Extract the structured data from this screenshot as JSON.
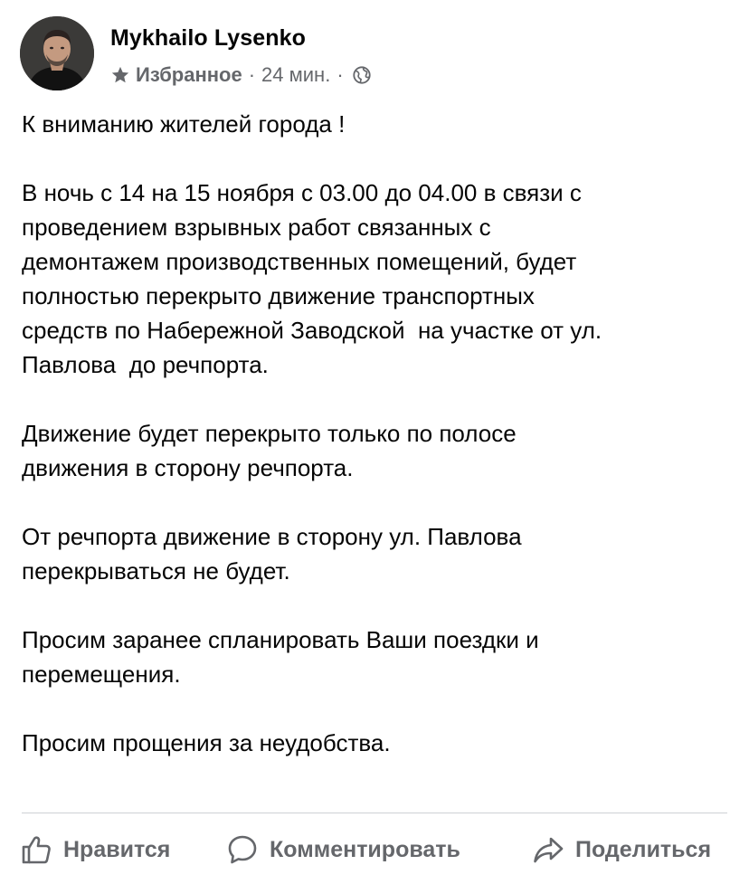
{
  "post": {
    "author": "Mykhailo Lysenko",
    "meta": {
      "favorite_label": "Избранное",
      "separator": "·",
      "time": "24 мин.",
      "icons": [
        "star-icon",
        "globe-icon"
      ]
    },
    "paragraphs": [
      "К вниманию жителей города !",
      "В ночь с 14 на 15 ноября с 03.00 до 04.00 в связи с\nпроведением взрывных работ связанных с\nдемонтажем производственных помещений, будет\nполностью перекрыто движение транспортных\nсредств по Набережной Заводской  на участке от ул.\nПавлова  до речпорта.",
      "Движение будет перекрыто только по полосе\nдвижения в сторону речпорта.",
      "От речпорта движение в сторону ул. Павлова\nперекрываться не будет.",
      "Просим заранее спланировать Ваши поездки и\nперемещения.",
      "Просим прощения за неудобства."
    ]
  },
  "actions": {
    "like_label": "Нравится",
    "comment_label": "Комментировать",
    "share_label": "Поделиться"
  },
  "colors": {
    "text": "#050505",
    "secondary": "#65676b",
    "divider": "#ced0d4"
  }
}
